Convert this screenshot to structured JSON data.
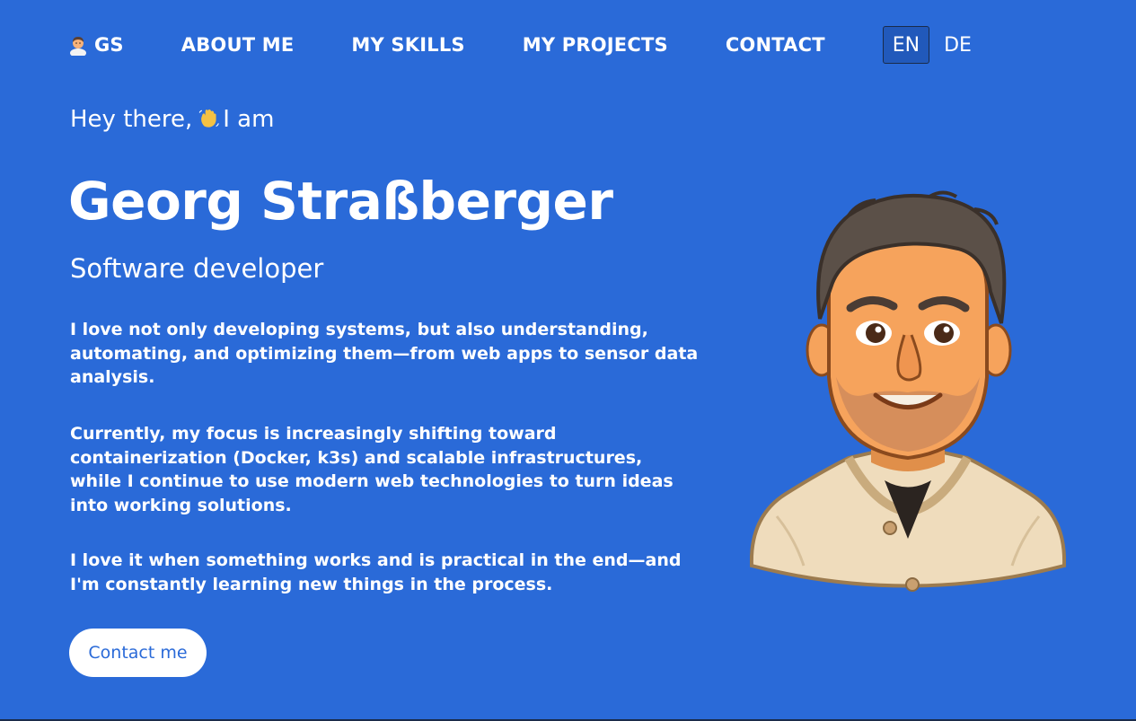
{
  "nav": {
    "logo_text": "GS",
    "items": [
      {
        "label": "ABOUT ME"
      },
      {
        "label": "MY SKILLS"
      },
      {
        "label": "MY PROJECTS"
      },
      {
        "label": "CONTACT"
      }
    ],
    "languages": [
      {
        "label": "EN",
        "active": true
      },
      {
        "label": "DE",
        "active": false
      }
    ]
  },
  "hero": {
    "greeting_before": "Hey there,",
    "greeting_after": "I am",
    "name": "Georg Straßberger",
    "role": "Software developer",
    "paragraphs": [
      "I love not only developing systems, but also understanding, automating, and optimizing them—from web apps to sensor data analysis.",
      "Currently, my focus is increasingly shifting toward containerization (Docker, k3s) and scalable infrastructures, while I continue to use modern web technologies to turn ideas into working solutions.",
      "I love it when something works and is practical in the end—and I'm constantly learning new things in the process."
    ],
    "cta_label": "Contact me"
  },
  "icons": {
    "logo": "man-technologist-icon",
    "wave": "waving-hand-icon",
    "avatar": "developer-avatar-illustration"
  },
  "colors": {
    "background": "#2a6ad8",
    "text": "#ffffff",
    "button_bg": "#ffffff",
    "button_text": "#2a6ad8",
    "active_lang_bg": "#2159bb"
  }
}
